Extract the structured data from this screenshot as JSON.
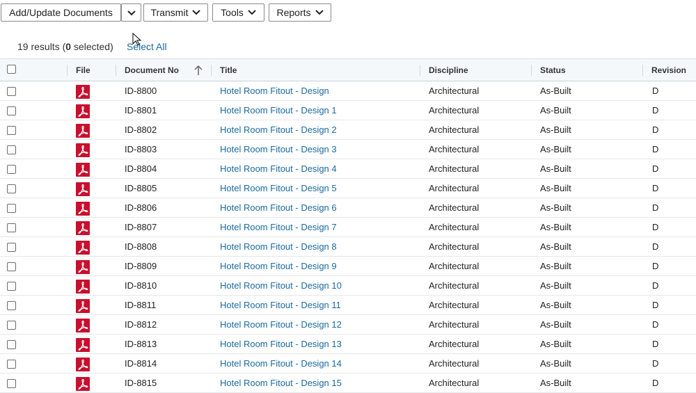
{
  "toolbar": {
    "add_update_label": "Add/Update Documents",
    "transmit_label": "Transmit",
    "tools_label": "Tools",
    "reports_label": "Reports"
  },
  "summary": {
    "count_text": "19 results (",
    "selected_count": "0",
    "selected_text": " selected)",
    "select_all_label": "Select All"
  },
  "columns": {
    "file": "File",
    "document_no": "Document No",
    "title": "Title",
    "discipline": "Discipline",
    "status": "Status",
    "revision": "Revision"
  },
  "icons": {
    "file_type": "pdf-icon",
    "sort": "sort-ascending-icon",
    "pdf_color": "#c8102e"
  },
  "rows": [
    {
      "doc": "ID-8800",
      "title": "Hotel Room Fitout - Design",
      "discipline": "Architectural",
      "status": "As-Built",
      "revision": "D"
    },
    {
      "doc": "ID-8801",
      "title": "Hotel Room Fitout - Design 1",
      "discipline": "Architectural",
      "status": "As-Built",
      "revision": "D"
    },
    {
      "doc": "ID-8802",
      "title": "Hotel Room Fitout - Design 2",
      "discipline": "Architectural",
      "status": "As-Built",
      "revision": "D"
    },
    {
      "doc": "ID-8803",
      "title": "Hotel Room Fitout - Design 3",
      "discipline": "Architectural",
      "status": "As-Built",
      "revision": "D"
    },
    {
      "doc": "ID-8804",
      "title": "Hotel Room Fitout - Design 4",
      "discipline": "Architectural",
      "status": "As-Built",
      "revision": "D"
    },
    {
      "doc": "ID-8805",
      "title": "Hotel Room Fitout - Design 5",
      "discipline": "Architectural",
      "status": "As-Built",
      "revision": "D"
    },
    {
      "doc": "ID-8806",
      "title": "Hotel Room Fitout - Design 6",
      "discipline": "Architectural",
      "status": "As-Built",
      "revision": "D"
    },
    {
      "doc": "ID-8807",
      "title": "Hotel Room Fitout - Design 7",
      "discipline": "Architectural",
      "status": "As-Built",
      "revision": "D"
    },
    {
      "doc": "ID-8808",
      "title": "Hotel Room Fitout - Design 8",
      "discipline": "Architectural",
      "status": "As-Built",
      "revision": "D"
    },
    {
      "doc": "ID-8809",
      "title": "Hotel Room Fitout - Design 9",
      "discipline": "Architectural",
      "status": "As-Built",
      "revision": "D"
    },
    {
      "doc": "ID-8810",
      "title": "Hotel Room Fitout - Design 10",
      "discipline": "Architectural",
      "status": "As-Built",
      "revision": "D"
    },
    {
      "doc": "ID-8811",
      "title": "Hotel Room Fitout - Design 11",
      "discipline": "Architectural",
      "status": "As-Built",
      "revision": "D"
    },
    {
      "doc": "ID-8812",
      "title": "Hotel Room Fitout - Design 12",
      "discipline": "Architectural",
      "status": "As-Built",
      "revision": "D"
    },
    {
      "doc": "ID-8813",
      "title": "Hotel Room Fitout - Design 13",
      "discipline": "Architectural",
      "status": "As-Built",
      "revision": "D"
    },
    {
      "doc": "ID-8814",
      "title": "Hotel Room Fitout - Design 14",
      "discipline": "Architectural",
      "status": "As-Built",
      "revision": "D"
    },
    {
      "doc": "ID-8815",
      "title": "Hotel Room Fitout - Design 15",
      "discipline": "Architectural",
      "status": "As-Built",
      "revision": "D"
    }
  ]
}
